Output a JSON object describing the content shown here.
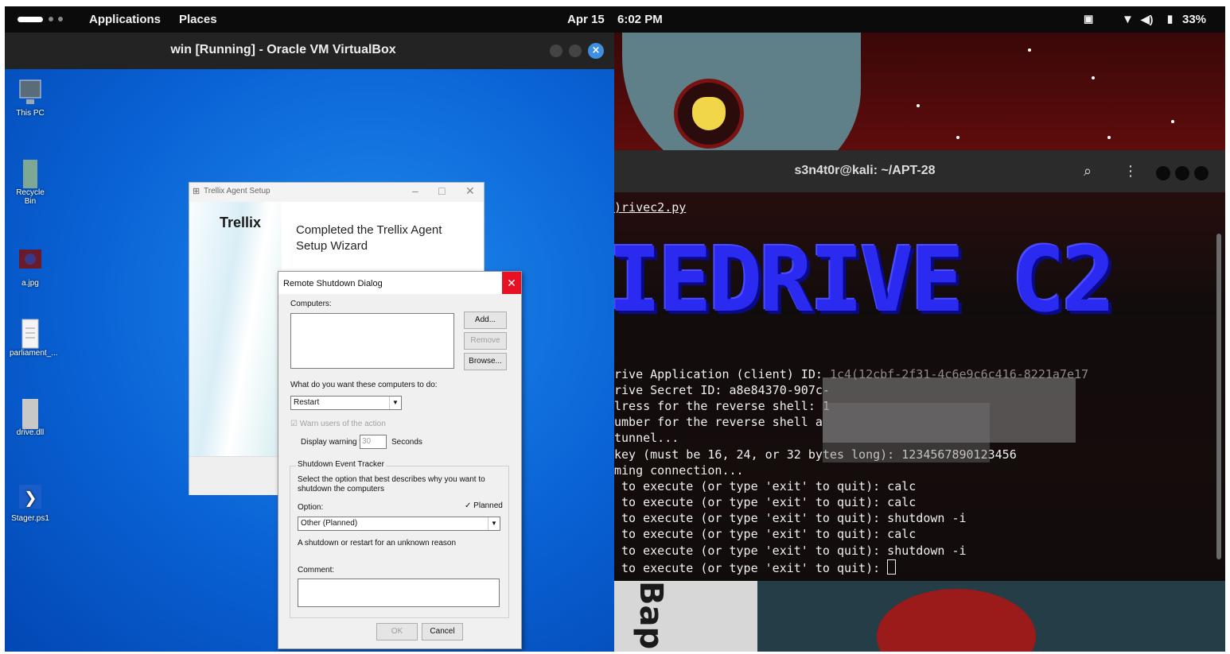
{
  "topbar": {
    "applications": "Applications",
    "places": "Places",
    "date": "Apr 15",
    "time": "6:02 PM",
    "battery": "33%"
  },
  "vbox": {
    "title": "win [Running] - Oracle VM VirtualBox",
    "close_glyph": "×"
  },
  "desktop": {
    "icons": [
      {
        "label": "This PC",
        "icon": "computer-icon"
      },
      {
        "label": "Recycle Bin",
        "icon": "recycle-bin-icon"
      },
      {
        "label": "a.jpg",
        "icon": "image-file-icon"
      },
      {
        "label": "parliament_...",
        "icon": "document-icon"
      },
      {
        "label": "drive.dll",
        "icon": "dll-file-icon"
      },
      {
        "label": "Stager.ps1",
        "icon": "powershell-icon"
      }
    ]
  },
  "trellix": {
    "window_title": "Trellix Agent Setup",
    "logo": "Trellix",
    "heading": "Completed the Trellix Agent Setup Wizard",
    "min_glyph": "–",
    "max_glyph": "□",
    "close_glyph": "✕"
  },
  "shutdown": {
    "title": "Remote Shutdown Dialog",
    "close_glyph": "✕",
    "computers_label": "Computers:",
    "add": "Add...",
    "remove": "Remove",
    "browse": "Browse...",
    "what_label": "What do you want these computers to do:",
    "action_value": "Restart",
    "warn_label": "Warn users of the action",
    "display_label": "Display warning for",
    "display_value": "30",
    "seconds": "Seconds",
    "tracker_label": "Shutdown Event Tracker",
    "tracker_desc": "Select the option that best describes why you want to shutdown the computers",
    "option_label": "Option:",
    "planned_label": "Planned",
    "option_value": "Other (Planned)",
    "reason_text": "A shutdown or restart for an unknown reason",
    "comment_label": "Comment:",
    "ok": "OK",
    "cancel": "Cancel",
    "check_glyph": "✓",
    "dropdown_glyph": "▼"
  },
  "terminal": {
    "title": "s3n4t0r@kali: ~/APT-28",
    "banner": "IEDRIVE C2",
    "lines": [
      ")rivec2.py",
      "rive Application (client) ID: ",
      "rive Secret ID: a8e84370-907c-",
      "lress for the reverse shell: 1",
      "umber for the reverse shell a",
      "tunnel...",
      "key (must be 16, 24, or 32 bytes long): 1234567890123456",
      "ming connection...",
      " to execute (or type 'exit' to quit): calc",
      " to execute (or type 'exit' to quit): calc",
      " to execute (or type 'exit' to quit): shutdown -i",
      " to execute (or type 'exit' to quit): calc",
      " to execute (or type 'exit' to quit): shutdown -i",
      " to execute (or type 'exit' to quit): "
    ],
    "client_id_tail": "1c4(12cbf-2f31-4c6e9c6c416-8221a7e17"
  },
  "wallpaper": {
    "text": "Bap"
  },
  "colors": {
    "win_blue": "#0a62d4",
    "terminal_banner": "#2a2af0",
    "close_red": "#e81123",
    "vbox_close": "#3d8fe0"
  }
}
